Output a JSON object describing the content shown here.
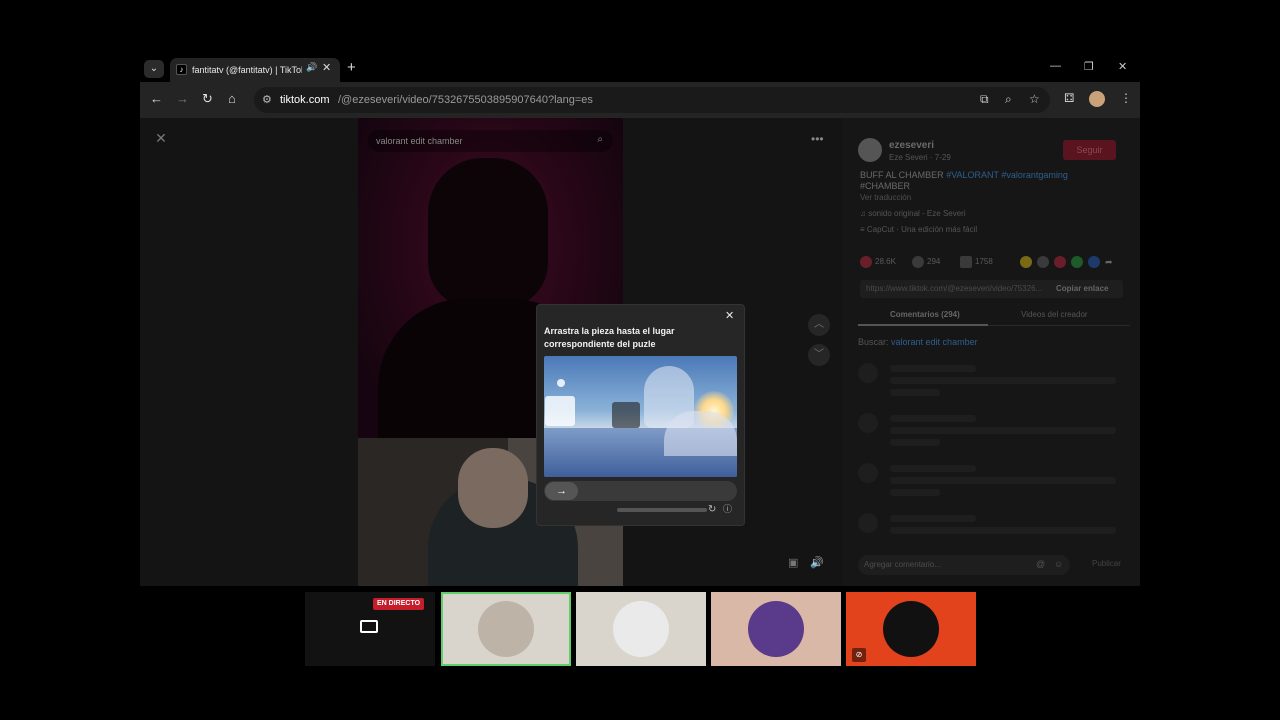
{
  "browser": {
    "tab": {
      "title": "fantitatv (@fantitatv) | TikTok",
      "favicon": "tiktok-icon"
    },
    "url": {
      "host": "tiktok.com",
      "path": "/@ezeseveri/video/7532675503895907640?lang=es"
    }
  },
  "video": {
    "search_placeholder": "valorant edit chamber"
  },
  "panel": {
    "username": "ezeseveri",
    "display": "Eze Severi · 7-29",
    "follow_label": "Seguir",
    "desc_prefix": "BUFF AL CHAMBER",
    "desc_tags": "#VALORANT #valorantgaming",
    "desc_tag2": "#CHAMBER",
    "translate": "Ver traducción",
    "music": "sonido original - Eze Severi",
    "capcut": "CapCut · Una edición más fácil",
    "likes": "28.6K",
    "comments": "294",
    "saves": "1758",
    "link": "https://www.tiktok.com/@ezeseveri/video/75326...",
    "copy_label": "Copiar enlace",
    "tab_comments": "Comentarios (294)",
    "tab_videos": "Videos del creador",
    "search_label": "Buscar:",
    "search_query": "valorant edit chamber",
    "comment_placeholder": "Agregar comentario...",
    "publish_label": "Publicar"
  },
  "captcha": {
    "title": "Arrastra la pieza hasta el lugar correspondiente del puzle",
    "slider_icon": "arrow-right-icon"
  },
  "strip": {
    "live_label": "EN DIRECTO"
  },
  "colors": {
    "live_red": "#c61d2b",
    "follow_red": "#5a1420",
    "orange": "#e2431c"
  }
}
